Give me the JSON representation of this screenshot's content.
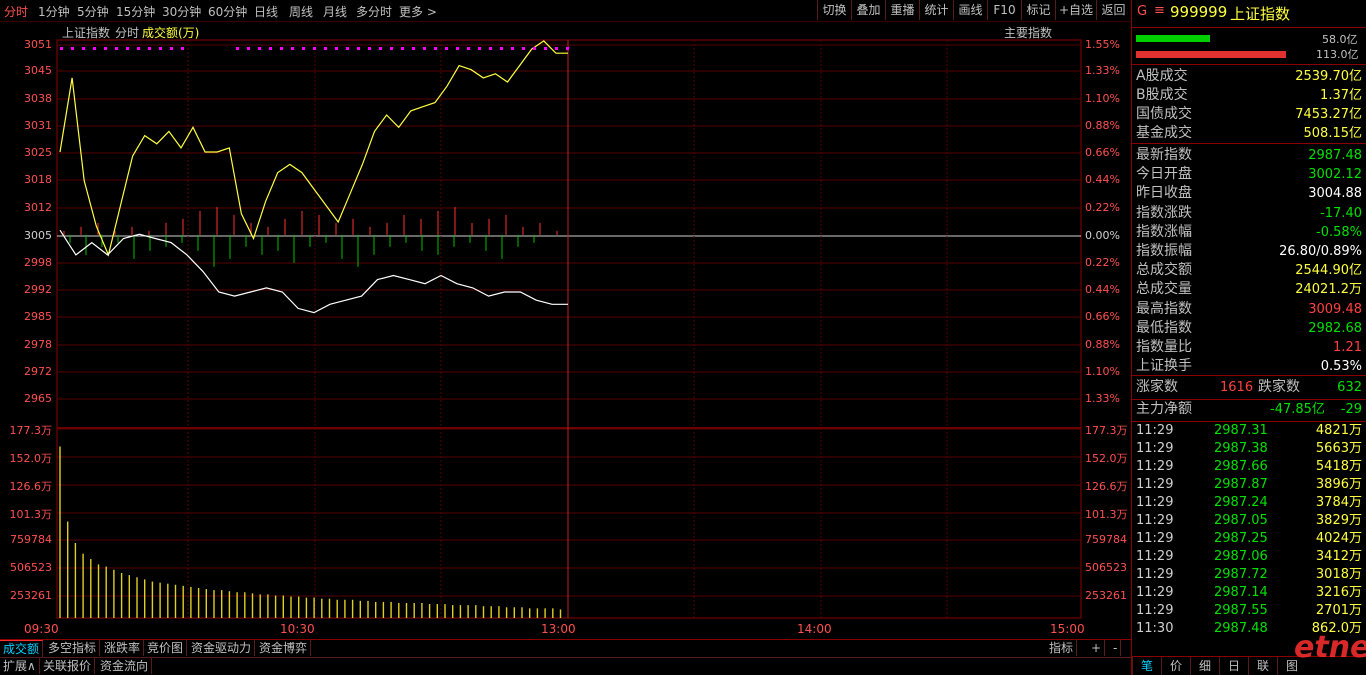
{
  "toolbar": {
    "periods": [
      "分时",
      "1分钟",
      "5分钟",
      "15分钟",
      "30分钟",
      "60分钟",
      "日线",
      "周线",
      "月线",
      "多分时",
      "更多 >"
    ],
    "actions": [
      "切换",
      "叠加",
      "重播",
      "统计",
      "画线",
      "F10",
      "标记",
      "+自选",
      "返回"
    ]
  },
  "chart_header": {
    "name": "上证指数",
    "mode": "分时",
    "volume_label": "成交额(万)",
    "main_index": "主要指数"
  },
  "price_axis": {
    "left": [
      "3051",
      "3045",
      "3038",
      "3031",
      "3025",
      "3018",
      "3012",
      "3005",
      "2998",
      "2992",
      "2985",
      "2978",
      "2972",
      "2965"
    ],
    "right": [
      "1.55%",
      "1.33%",
      "1.10%",
      "0.88%",
      "0.66%",
      "0.44%",
      "0.22%",
      "0.00%",
      "0.22%",
      "0.44%",
      "0.66%",
      "0.88%",
      "1.10%",
      "1.33%"
    ]
  },
  "volume_axis": {
    "left": [
      "177.3万",
      "152.0万",
      "126.6万",
      "101.3万",
      "759784",
      "506523",
      "253261"
    ],
    "right": [
      "177.3万",
      "152.0万",
      "126.6万",
      "101.3万",
      "759784",
      "506523",
      "253261"
    ]
  },
  "time_axis": [
    "09:30",
    "10:30",
    "13:00",
    "14:00",
    "15:00"
  ],
  "chart_data": {
    "type": "line",
    "x_range": [
      "09:30",
      "15:00"
    ],
    "y_range": [
      2965,
      3051
    ],
    "base_price": 3004.88,
    "series": [
      {
        "name": "上证指数",
        "color": "#ffff40",
        "values": [
          3025,
          3043,
          3018,
          3007,
          3000,
          3012,
          3024,
          3029,
          3027,
          3030,
          3026,
          3031,
          3025,
          3025,
          3026,
          3010,
          3004,
          3013,
          3020,
          3022,
          3020,
          3016,
          3012,
          3008,
          3015,
          3022,
          3030,
          3034,
          3031,
          3035,
          3036,
          3037,
          3041,
          3046,
          3045,
          3043,
          3044,
          3042,
          3046,
          3050,
          3052,
          3049,
          3049
        ]
      },
      {
        "color": "#ffffff",
        "values": [
          3006,
          3000,
          3003,
          3000,
          3004,
          3005,
          3004,
          3003,
          3000,
          2996,
          2991,
          2990,
          2991,
          2992,
          2991,
          2987,
          2986,
          2988,
          2989,
          2990,
          2994,
          2995,
          2994,
          2993,
          2995,
          2993,
          2992,
          2990,
          2991,
          2991,
          2989,
          2988,
          2988
        ]
      }
    ],
    "bars_red": [
      1,
      2,
      3,
      1,
      2,
      1,
      3,
      4,
      6,
      7,
      5,
      3,
      2,
      4,
      6,
      5,
      3,
      4,
      2,
      3,
      5,
      4,
      6,
      7,
      3,
      4,
      5,
      2,
      3,
      1
    ],
    "bars_green": [
      2,
      5,
      3,
      2,
      6,
      4,
      3,
      2,
      4,
      8,
      6,
      3,
      5,
      4,
      7,
      3,
      2,
      6,
      8,
      5,
      3,
      2,
      4,
      5,
      3,
      2,
      4,
      6,
      3,
      2
    ],
    "volume": [
      160,
      90,
      70,
      60,
      55,
      50,
      48,
      45,
      42,
      40,
      38,
      36,
      34,
      33,
      32,
      31,
      30,
      29,
      28,
      27,
      26,
      26,
      25,
      24,
      24,
      23,
      22,
      22,
      21,
      21,
      20,
      20,
      19,
      19,
      18,
      18,
      17,
      17,
      17,
      16,
      16,
      15,
      15,
      15,
      14,
      14,
      14,
      14,
      13,
      13,
      13,
      12,
      12,
      12,
      12,
      11,
      11,
      11,
      10,
      10,
      10,
      9,
      9,
      9,
      9,
      8
    ]
  },
  "panel": {
    "code_prefix": "G",
    "code": "999999",
    "title": "上证指数",
    "bar_values": [
      "58.0亿",
      "113.0亿"
    ],
    "bar_colors": [
      "#00d000",
      "#e03030"
    ],
    "rows1": [
      {
        "k": "A股成交",
        "v": "2539.70亿",
        "c": "#ffff40"
      },
      {
        "k": "B股成交",
        "v": "1.37亿",
        "c": "#ffff40"
      },
      {
        "k": "国债成交",
        "v": "7453.27亿",
        "c": "#ffff40"
      },
      {
        "k": "基金成交",
        "v": "508.15亿",
        "c": "#ffff40"
      }
    ],
    "rows2": [
      {
        "k": "最新指数",
        "v": "2987.48",
        "c": "#00e000"
      },
      {
        "k": "今日开盘",
        "v": "3002.12",
        "c": "#00e000"
      },
      {
        "k": "昨日收盘",
        "v": "3004.88",
        "c": "#ffffff"
      },
      {
        "k": "指数涨跌",
        "v": "-17.40",
        "c": "#00e000"
      },
      {
        "k": "指数涨幅",
        "v": "-0.58%",
        "c": "#00e000"
      },
      {
        "k": "指数振幅",
        "v": "26.80/0.89%",
        "c": "#ffffff"
      },
      {
        "k": "总成交额",
        "v": "2544.90亿",
        "c": "#ffff40"
      },
      {
        "k": "总成交量",
        "v": "24021.2万",
        "c": "#ffff40"
      },
      {
        "k": "最高指数",
        "v": "3009.48",
        "c": "#ff4040"
      },
      {
        "k": "最低指数",
        "v": "2982.68",
        "c": "#00e000"
      },
      {
        "k": "指数量比",
        "v": "1.21",
        "c": "#ff4040"
      },
      {
        "k": "上证换手",
        "v": "0.53%",
        "c": "#ffffff"
      }
    ],
    "rise_label": "涨家数",
    "rise_value": "1616",
    "fall_label": "跌家数",
    "fall_value": "632",
    "net_label": "主力净额",
    "net_value": "-47.85亿",
    "net_extra": "-29",
    "ticks": [
      {
        "t": "11:29",
        "p": "2987.31",
        "q": "4821万"
      },
      {
        "t": "11:29",
        "p": "2987.38",
        "q": "5663万"
      },
      {
        "t": "11:29",
        "p": "2987.66",
        "q": "5418万"
      },
      {
        "t": "11:29",
        "p": "2987.87",
        "q": "3896万"
      },
      {
        "t": "11:29",
        "p": "2987.24",
        "q": "3784万"
      },
      {
        "t": "11:29",
        "p": "2987.05",
        "q": "3829万"
      },
      {
        "t": "11:29",
        "p": "2987.25",
        "q": "4024万"
      },
      {
        "t": "11:29",
        "p": "2987.06",
        "q": "3412万"
      },
      {
        "t": "11:29",
        "p": "2987.72",
        "q": "3018万"
      },
      {
        "t": "11:29",
        "p": "2987.14",
        "q": "3216万"
      },
      {
        "t": "11:29",
        "p": "2987.55",
        "q": "2701万"
      },
      {
        "t": "11:30",
        "p": "2987.48",
        "q": "862.0万"
      }
    ],
    "bottom_tabs": [
      "笔",
      "价",
      "细",
      "日",
      "联",
      "图"
    ],
    "watermark": "etnet"
  },
  "bottom": {
    "tabs": [
      "成交额",
      "多空指标",
      "涨跌率",
      "竞价图",
      "资金驱动力",
      "资金博弈"
    ],
    "tabs2": [
      "扩展∧",
      "关联报价",
      "资金流向"
    ],
    "right": [
      "指标",
      "+",
      "-"
    ]
  }
}
